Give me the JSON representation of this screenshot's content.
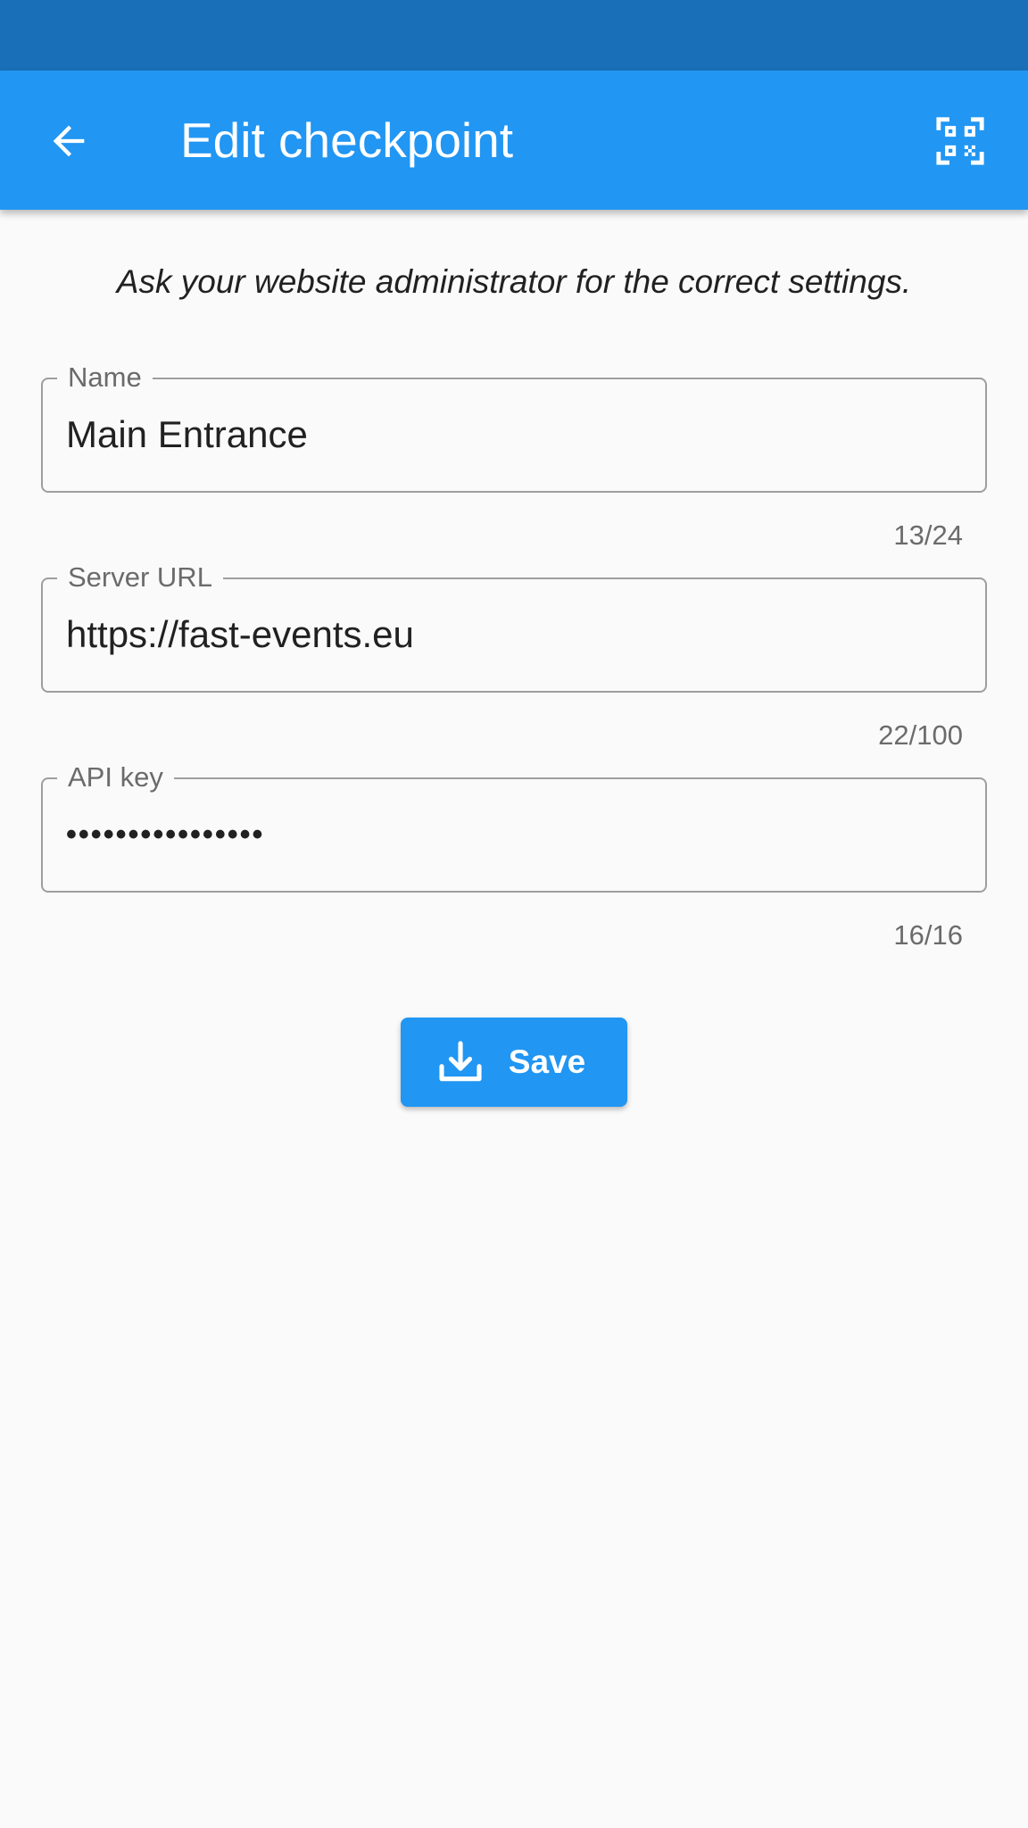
{
  "app_bar": {
    "title": "Edit checkpoint",
    "back_icon": "arrow-back-icon",
    "qr_icon": "qr-code-scanner-icon",
    "color": "#2196f3",
    "status_bar_color": "#1a70b8"
  },
  "hint": "Ask your website administrator for the correct settings.",
  "fields": {
    "name": {
      "label": "Name",
      "value": "Main Entrance",
      "counter": "13/24"
    },
    "server_url": {
      "label": "Server URL",
      "value": "https://fast-events.eu",
      "counter": "22/100"
    },
    "api_key": {
      "label": "API key",
      "value": "••••••••••••••••",
      "counter": "16/16"
    }
  },
  "save_button": {
    "label": "Save",
    "icon": "download-icon"
  }
}
